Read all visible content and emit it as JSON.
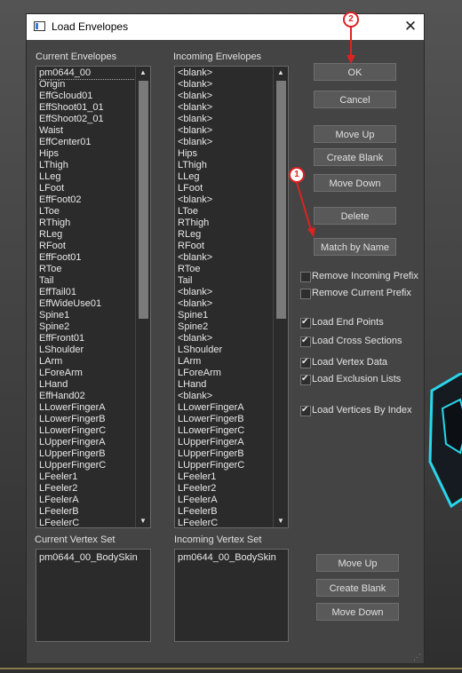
{
  "window": {
    "title": "Load Envelopes",
    "close_glyph": "✕"
  },
  "labels": {
    "current_envelopes": "Current Envelopes",
    "incoming_envelopes": "Incoming Envelopes",
    "current_vertex_set": "Current Vertex Set",
    "incoming_vertex_set": "Incoming Vertex Set"
  },
  "current_envelopes": [
    "pm0644_00",
    "Origin",
    "EffGcloud01",
    "EffShoot01_01",
    "EffShoot02_01",
    "Waist",
    "EffCenter01",
    "Hips",
    "LThigh",
    "LLeg",
    "LFoot",
    "EffFoot02",
    "LToe",
    "RThigh",
    "RLeg",
    "RFoot",
    "EffFoot01",
    "RToe",
    "Tail",
    "EffTail01",
    "EffWideUse01",
    "Spine1",
    "Spine2",
    "EffFront01",
    "LShoulder",
    "LArm",
    "LForeArm",
    "LHand",
    "EffHand02",
    "LLowerFingerA",
    "LLowerFingerB",
    "LLowerFingerC",
    "LUpperFingerA",
    "LUpperFingerB",
    "LUpperFingerC",
    "LFeeler1",
    "LFeeler2",
    "LFeelerA",
    "LFeelerB",
    "LFeelerC"
  ],
  "incoming_envelopes": [
    "<blank>",
    "<blank>",
    "<blank>",
    "<blank>",
    "<blank>",
    "<blank>",
    "<blank>",
    "Hips",
    "LThigh",
    "LLeg",
    "LFoot",
    "<blank>",
    "LToe",
    "RThigh",
    "RLeg",
    "RFoot",
    "<blank>",
    "RToe",
    "Tail",
    "<blank>",
    "<blank>",
    "Spine1",
    "Spine2",
    "<blank>",
    "LShoulder",
    "LArm",
    "LForeArm",
    "LHand",
    "<blank>",
    "LLowerFingerA",
    "LLowerFingerB",
    "LLowerFingerC",
    "LUpperFingerA",
    "LUpperFingerB",
    "LUpperFingerC",
    "LFeeler1",
    "LFeeler2",
    "LFeelerA",
    "LFeelerB",
    "LFeelerC"
  ],
  "current_vertex_set": [
    "pm0644_00_BodySkin"
  ],
  "incoming_vertex_set": [
    "pm0644_00_BodySkin"
  ],
  "buttons": {
    "ok": "OK",
    "cancel": "Cancel",
    "move_up": "Move Up",
    "create_blank": "Create Blank",
    "move_down": "Move Down",
    "delete": "Delete",
    "match_by_name": "Match by Name",
    "vs_move_up": "Move Up",
    "vs_create_blank": "Create Blank",
    "vs_move_down": "Move Down"
  },
  "checkboxes": [
    {
      "label": "Remove Incoming Prefix",
      "checked": false
    },
    {
      "label": "Remove Current Prefix",
      "checked": false
    },
    {
      "label": "Load End Points",
      "checked": true
    },
    {
      "label": "Load Cross Sections",
      "checked": true
    },
    {
      "label": "Load Vertex Data",
      "checked": true
    },
    {
      "label": "Load Exclusion Lists",
      "checked": true
    },
    {
      "label": "Load Vertices By Index",
      "checked": true
    }
  ],
  "annotations": {
    "step_a": "2",
    "step_b": "1",
    "color": "#dd2222"
  },
  "colors": {
    "dialog_bg": "#444444",
    "list_bg": "#2b2b2b",
    "button_bg": "#595959",
    "cyan_accent": "#29d6ea"
  }
}
